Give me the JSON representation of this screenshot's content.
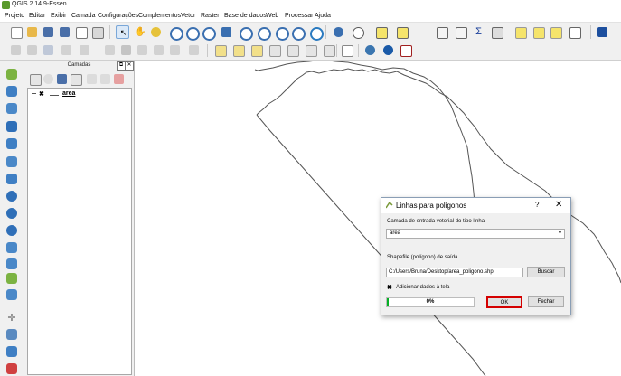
{
  "window": {
    "title": "QGIS 2.14.9-Essen"
  },
  "menu": [
    "Projeto",
    "Editar",
    "Exibir",
    "Camada",
    "Configurações",
    "Complementos",
    "Vetor",
    "Raster",
    "Base de dados",
    "Web",
    "Processar",
    "Ajuda"
  ],
  "layers_panel": {
    "title": "Camadas",
    "layers": [
      {
        "name": "area",
        "visible": true
      }
    ]
  },
  "dialog": {
    "title": "Linhas para poligonos",
    "help_label": "?",
    "close_label": "✕",
    "input_label": "Camada de entrada vetorial do tipo linha",
    "input_value": "area",
    "output_label": "Shapefile (polígono) de saída",
    "output_value": "C:/Users/Bruna/Desktop/area_poligono.shp",
    "browse_label": "Buscar",
    "add_checkbox_label": "Adicionar dados à tela",
    "add_checked": true,
    "progress_percent": 0,
    "progress_text": "0%",
    "ok_label": "OK",
    "close_button_label": "Fechar"
  },
  "colors": {
    "ok_highlight": "#d40000",
    "progress_fill": "#06b025",
    "qgis_green": "#5a9a2c"
  },
  "toolbar_icons": [
    "new-project-icon",
    "open-project-icon",
    "save-project-icon",
    "save-as-icon",
    "new-print-composer-icon",
    "composer-manager-icon",
    "touch-zoom-icon",
    "pan-icon",
    "pan-to-selection-icon",
    "zoom-in-icon",
    "zoom-out-icon",
    "zoom-native-icon",
    "zoom-full-icon",
    "zoom-to-selection-icon",
    "zoom-to-layer-icon",
    "zoom-last-icon",
    "zoom-next-icon",
    "refresh-icon",
    "identify-icon",
    "measure-icon",
    "select-icon",
    "deselect-icon",
    "attribute-table-icon",
    "field-calculator-icon",
    "statistics-icon",
    "measure-line-icon",
    "map-tips-icon",
    "new-bookmark-icon",
    "bookmarks-icon",
    "text-annotation-icon",
    "help-icon"
  ]
}
